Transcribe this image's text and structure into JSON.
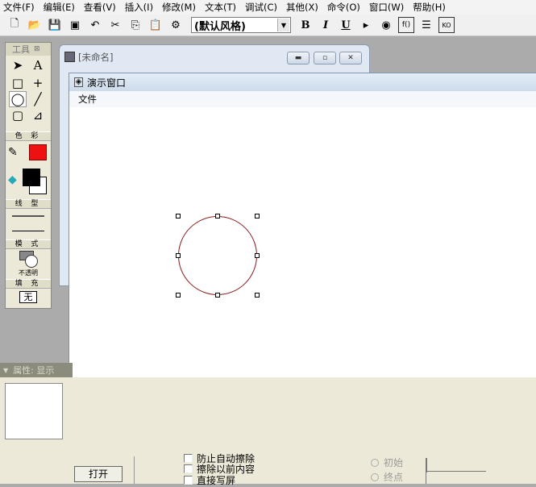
{
  "menu": [
    "文件(F)",
    "编辑(E)",
    "查看(V)",
    "插入(I)",
    "修改(M)",
    "文本(T)",
    "调试(C)",
    "其他(X)",
    "命令(O)",
    "窗口(W)",
    "帮助(H)"
  ],
  "toolbar": {
    "style": "(默认风格)",
    "bold": "B",
    "italic": "I",
    "underline": "U"
  },
  "tools": {
    "title": "工具",
    "color_label": "色 彩",
    "line_label": "线 型",
    "mode_label": "模 式",
    "mode_value": "不透明",
    "fill_label": "填 充",
    "fill_value": "无",
    "text_tool": "A",
    "stroke_color": "#000000",
    "text_color": "#ee1111"
  },
  "untitled_window": {
    "title": "[未命名]"
  },
  "presentation_window": {
    "title": "演示窗口",
    "menu": "文件"
  },
  "shape": {
    "type": "circle",
    "stroke": "#8b1a1a"
  },
  "properties": {
    "header": "属性: 显示",
    "open_button": "打开",
    "checkboxes": [
      "防止自动擦除",
      "擦除以前内容",
      "直接写屏"
    ],
    "radios": [
      "初始",
      "终点"
    ]
  }
}
